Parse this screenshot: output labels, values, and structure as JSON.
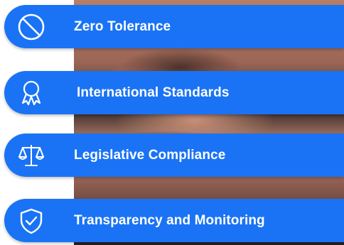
{
  "theme": {
    "band_color": "#1a73f5",
    "text_color": "#ffffff"
  },
  "items": [
    {
      "label": "Zero Tolerance",
      "icon": "prohibited-icon"
    },
    {
      "label": "International Standards",
      "icon": "award-ribbon-icon"
    },
    {
      "label": "Legislative Compliance",
      "icon": "scales-of-justice-icon"
    },
    {
      "label": "Transparency and Monitoring",
      "icon": "shield-check-icon"
    }
  ]
}
